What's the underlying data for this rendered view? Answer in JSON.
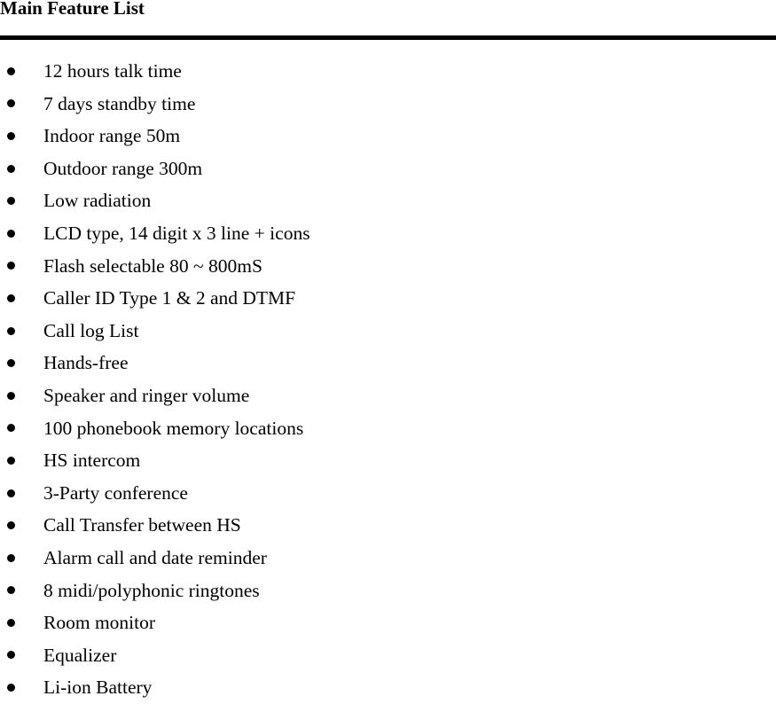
{
  "document": {
    "title": "Main Feature List",
    "bullet_icon": "bullet-dot-icon",
    "rule_color": "#000000",
    "text_color": "#000000",
    "background_color": "#ffffff",
    "features": [
      {
        "label": "12 hours talk time"
      },
      {
        "label": "7 days standby time"
      },
      {
        "label": "Indoor range 50m"
      },
      {
        "label": "Outdoor range 300m"
      },
      {
        "label": "Low radiation"
      },
      {
        "label": "LCD type, 14 digit x 3 line + icons"
      },
      {
        "label": "Flash selectable 80 ~ 800mS"
      },
      {
        "label": "Caller ID Type 1 & 2 and DTMF"
      },
      {
        "label": "Call log List"
      },
      {
        "label": "Hands-free"
      },
      {
        "label": "Speaker and ringer volume"
      },
      {
        "label": "100 phonebook memory locations"
      },
      {
        "label": "HS intercom"
      },
      {
        "label": "3-Party conference"
      },
      {
        "label": "Call Transfer between HS"
      },
      {
        "label": "Alarm call and date reminder"
      },
      {
        "label": "8 midi/polyphonic ringtones"
      },
      {
        "label": "Room monitor"
      },
      {
        "label": "Equalizer"
      },
      {
        "label": "Li-ion Battery"
      }
    ]
  }
}
